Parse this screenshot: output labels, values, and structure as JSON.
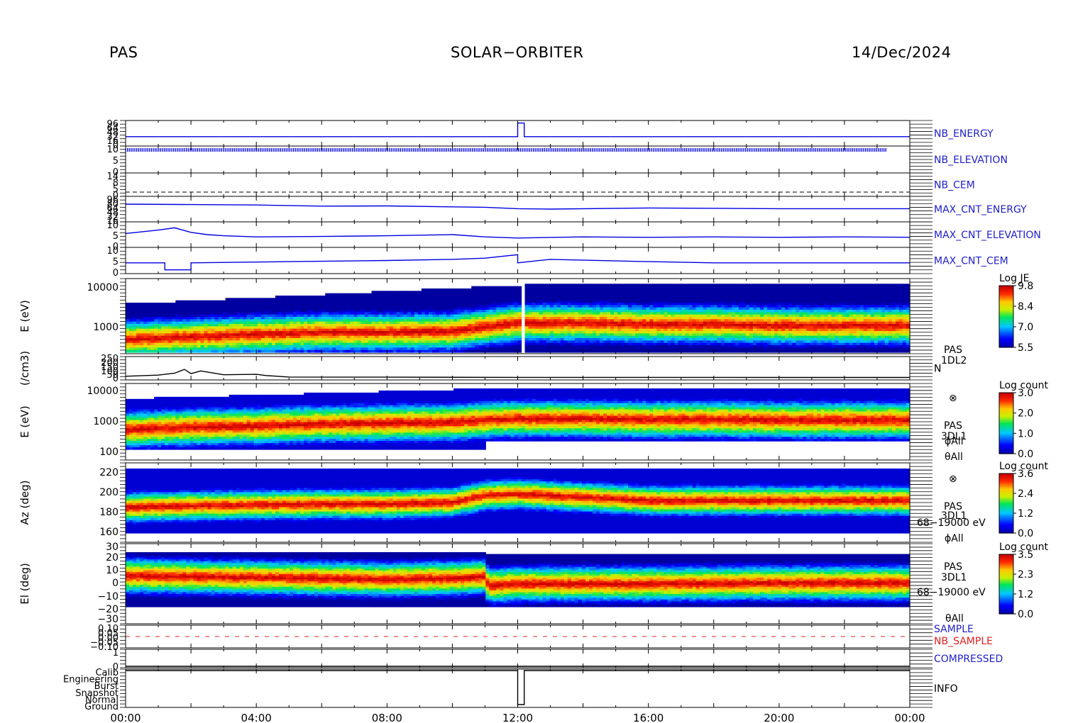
{
  "header": {
    "instrument": "PAS",
    "mission": "SOLAR−ORBITER",
    "date": "14/Dec/2024"
  },
  "colors": {
    "label_blue": "#1f1fc8",
    "trace_blue": "#0000e0",
    "sample_red": "#e02020",
    "axis": "#000000"
  },
  "chart_data": {
    "type": "heatmap",
    "x_axis": {
      "unit": "time",
      "range": [
        "00:00",
        "24:00"
      ],
      "tick_labels": [
        "00:00",
        "04:00",
        "08:00",
        "12:00",
        "16:00",
        "20:00",
        "00:00"
      ]
    },
    "panels": [
      {
        "id": "nb-energy",
        "kind": "line",
        "right_label": "NB_ENERGY",
        "ytick_labels": [
          "96",
          "64",
          "48",
          "32",
          "16",
          "0"
        ],
        "series": [
          {
            "x": [
              0,
              12.0,
              12.0,
              12.2,
              12.2,
              24
            ],
            "y": [
              0.35,
              0.35,
              0.95,
              0.95,
              0.35,
              0.35
            ]
          }
        ]
      },
      {
        "id": "nb-elevation",
        "kind": "line",
        "right_label": "NB_ELEVATION",
        "ytick_labels": [
          "10",
          "5",
          "0"
        ],
        "note_rendering": "dense blue comb",
        "series": [
          {
            "x": [
              0,
              23.3
            ],
            "y": [
              0.75,
              0.75
            ]
          }
        ]
      },
      {
        "id": "nb-cem",
        "kind": "line",
        "right_label": "NB_CEM",
        "ytick_labels": [
          "14",
          "8",
          "5",
          "0"
        ],
        "series": [
          {
            "x": [
              0,
              24
            ],
            "y": [
              0.4,
              0.4
            ]
          }
        ]
      },
      {
        "id": "max-cnt-energy",
        "kind": "line",
        "right_label": "MAX_CNT_ENERGY",
        "ytick_labels": [
          "96",
          "80",
          "64",
          "48",
          "32",
          "16"
        ],
        "series": [
          {
            "x": [
              0,
              2,
              4,
              6,
              8,
              10,
              11,
              12,
              13,
              16,
              20,
              24
            ],
            "y": [
              0.72,
              0.7,
              0.68,
              0.63,
              0.64,
              0.6,
              0.58,
              0.52,
              0.5,
              0.55,
              0.52,
              0.52
            ]
          }
        ]
      },
      {
        "id": "max-cnt-elevation",
        "kind": "line",
        "right_label": "MAX_CNT_ELEVATION",
        "ytick_labels": [
          "10",
          "5",
          "0"
        ],
        "series": [
          {
            "x": [
              0,
              1,
              1.5,
              2,
              2.5,
              3,
              4,
              6,
              8,
              10,
              11,
              12,
              14,
              16,
              18,
              20,
              22,
              24
            ],
            "y": [
              0.55,
              0.7,
              0.8,
              0.6,
              0.5,
              0.45,
              0.4,
              0.42,
              0.45,
              0.5,
              0.4,
              0.35,
              0.4,
              0.38,
              0.4,
              0.38,
              0.4,
              0.38
            ]
          }
        ]
      },
      {
        "id": "max-cnt-cem",
        "kind": "line",
        "right_label": "MAX_CNT_CEM",
        "ytick_labels": [
          "10",
          "5",
          "0"
        ],
        "series": [
          {
            "x": [
              0,
              1.2,
              1.2,
              2,
              2,
              5,
              8,
              10,
              11,
              12,
              12,
              13,
              16,
              18,
              20,
              24
            ],
            "y": [
              0.4,
              0.4,
              0.1,
              0.1,
              0.4,
              0.45,
              0.5,
              0.55,
              0.6,
              0.75,
              0.4,
              0.55,
              0.45,
              0.4,
              0.4,
              0.4
            ]
          }
        ]
      },
      {
        "id": "energy-spectrogram-1dl2",
        "kind": "spectrogram",
        "ylabel": "E (eV)",
        "yscale": "log",
        "ytick_labels": [
          "10000",
          "1000"
        ],
        "ytick_values": [
          10000,
          1000
        ],
        "ylim": [
          300,
          15000
        ],
        "colorbar": {
          "label": "Log JE",
          "ticks": [
            "9.8",
            "8.4",
            "7.0",
            "5.5"
          ],
          "range": [
            5.5,
            9.8
          ]
        },
        "side_text": [
          "PAS",
          "1DL2"
        ],
        "peak_energy_eV": {
          "x": [
            0,
            2,
            4,
            6,
            8,
            10,
            11,
            12,
            14,
            16,
            18,
            20,
            24
          ],
          "y": [
            600,
            700,
            800,
            900,
            900,
            950,
            1200,
            1500,
            1500,
            1400,
            1400,
            1300,
            1300
          ]
        },
        "gap_hours": [
          12.1,
          12.25
        ]
      },
      {
        "id": "density",
        "kind": "line",
        "ylabel": "(/cm3)",
        "right_label": "N",
        "ytick_labels": [
          "250",
          "200",
          "150",
          "100",
          "50",
          "0"
        ],
        "ylim": [
          0,
          250
        ],
        "series": [
          {
            "x": [
              0,
              1,
              1.5,
              1.8,
              2,
              2.3,
              3,
              4,
              4.3,
              5,
              8,
              12,
              16,
              20,
              24
            ],
            "y": [
              20,
              35,
              60,
              110,
              55,
              90,
              40,
              45,
              30,
              10,
              8,
              6,
              6,
              5,
              5
            ]
          }
        ]
      },
      {
        "id": "energy-spectrogram-3dl1",
        "kind": "spectrogram",
        "ylabel": "E (eV)",
        "yscale": "log",
        "ytick_labels": [
          "10000",
          "1000",
          "100"
        ],
        "ytick_values": [
          10000,
          1000,
          100
        ],
        "ylim": [
          80,
          15000
        ],
        "colorbar": {
          "label": "Log count",
          "ticks": [
            "3.0",
            "2.0",
            "1.0",
            "0.0"
          ],
          "range": [
            0,
            3
          ]
        },
        "side_text": [
          "⊗",
          "PAS",
          "3DL1",
          "ϕAll",
          "θAll"
        ],
        "peak_energy_eV": {
          "x": [
            0,
            2,
            4,
            6,
            8,
            10,
            11,
            12,
            14,
            16,
            18,
            20,
            24
          ],
          "y": [
            400,
            500,
            550,
            650,
            700,
            750,
            900,
            1000,
            1000,
            950,
            950,
            900,
            900
          ]
        }
      },
      {
        "id": "azimuth-spectrogram",
        "kind": "spectrogram",
        "ylabel": "Az (deg)",
        "ytick_labels": [
          "220",
          "200",
          "180",
          "160"
        ],
        "ytick_values": [
          220,
          200,
          180,
          160
        ],
        "ylim": [
          152,
          228
        ],
        "colorbar": {
          "label": "Log count",
          "ticks": [
            "3.6",
            "2.4",
            "1.2",
            "0.0"
          ],
          "range": [
            0,
            3.6
          ]
        },
        "side_text": [
          "⊗",
          "PAS",
          "3DL1",
          "68−19000 eV",
          "ϕAll"
        ],
        "peak_deg": {
          "x": [
            0,
            2,
            4,
            6,
            8,
            10,
            11,
            12,
            14,
            16,
            20,
            24
          ],
          "y": [
            182,
            184,
            185,
            186,
            186,
            188,
            196,
            198,
            194,
            190,
            190,
            190
          ]
        }
      },
      {
        "id": "elevation-spectrogram",
        "kind": "spectrogram",
        "ylabel": "El (deg)",
        "ytick_labels": [
          "30",
          "20",
          "10",
          "0",
          "−10",
          "−20",
          "−30"
        ],
        "ytick_values": [
          30,
          20,
          10,
          0,
          -10,
          -20,
          -30
        ],
        "ylim": [
          -30,
          30
        ],
        "colorbar": {
          "label": "Log count",
          "ticks": [
            "3.5",
            "2.3",
            "1.2",
            "0.0"
          ],
          "range": [
            0,
            3.5
          ]
        },
        "side_text": [
          "PAS",
          "3DL1",
          "68−19000 eV",
          "θAll"
        ],
        "peak_deg": {
          "x": [
            0,
            2,
            4,
            6,
            8,
            10,
            11,
            11.1,
            12,
            14,
            16,
            20,
            24
          ],
          "y": [
            4,
            3,
            2,
            1,
            0,
            1,
            3,
            -7,
            -5,
            -5,
            -5,
            -4,
            -4
          ]
        }
      },
      {
        "id": "sample",
        "kind": "line",
        "right_label": "SAMPLE",
        "right_label_2": "NB_SAMPLE",
        "ytick_labels": [
          "0.10",
          "0.05",
          "0.00",
          "−0.05",
          "−0.10"
        ],
        "series": [
          {
            "x": [
              0,
              24
            ],
            "y": [
              0.5,
              0.5
            ]
          }
        ]
      },
      {
        "id": "compressed",
        "kind": "line",
        "right_label": "COMPRESSED",
        "ytick_labels": [
          "1",
          "0"
        ],
        "series": [
          {
            "x": [
              0,
              24
            ],
            "y": [
              0.0,
              0.0
            ]
          }
        ]
      },
      {
        "id": "info",
        "kind": "line",
        "right_label": "INFO",
        "ytick_labels": [
          "Calib",
          "Engineering",
          "Burst",
          "Snapshot",
          "Normal",
          "Ground"
        ],
        "series": [
          {
            "x": [
              0,
              12.0,
              12.0,
              12.2,
              12.2,
              24
            ],
            "y": [
              5,
              5,
              0,
              0,
              5,
              5
            ]
          }
        ]
      }
    ]
  }
}
